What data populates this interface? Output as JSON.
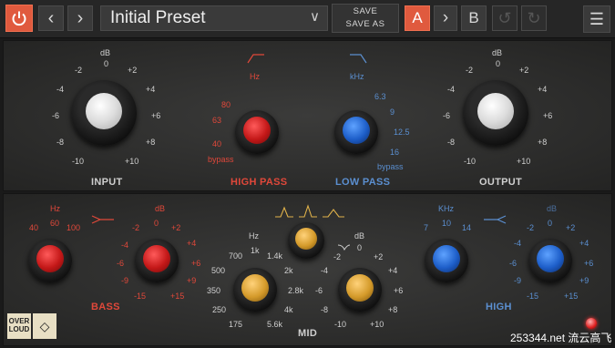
{
  "toolbar": {
    "preset_name": "Initial Preset",
    "save_label": "SAVE",
    "save_as_label": "SAVE AS",
    "a_label": "A",
    "b_label": "B"
  },
  "top": {
    "input": {
      "label": "INPUT",
      "unit": "dB",
      "scale": [
        "-10",
        "-8",
        "-6",
        "-4",
        "-2",
        "0",
        "+2",
        "+4",
        "+6",
        "+8",
        "+10"
      ]
    },
    "high_pass": {
      "label": "HIGH PASS",
      "unit": "Hz",
      "scale": [
        "bypass",
        "40",
        "63",
        "80"
      ]
    },
    "low_pass": {
      "label": "LOW PASS",
      "unit": "kHz",
      "scale": [
        "6.3",
        "9",
        "12.5",
        "16",
        "bypass"
      ]
    },
    "output": {
      "label": "OUTPUT",
      "unit": "dB",
      "scale": [
        "-10",
        "-8",
        "-6",
        "-4",
        "-2",
        "0",
        "+2",
        "+4",
        "+6",
        "+8",
        "+10"
      ]
    }
  },
  "bottom": {
    "bass": {
      "label": "BASS",
      "freq_unit": "Hz",
      "freqs": [
        "40",
        "60",
        "100"
      ],
      "gain_unit": "dB",
      "gain_scale": [
        "-15",
        "-9",
        "-6",
        "-4",
        "-2",
        "0",
        "+2",
        "+4",
        "+6",
        "+9",
        "+15"
      ]
    },
    "mid": {
      "label": "MID",
      "freq_unit": "Hz",
      "freq_scale": [
        "175",
        "250",
        "350",
        "500",
        "700",
        "1k",
        "1.4k",
        "2k",
        "2.8k",
        "4k",
        "5.6k"
      ],
      "gain_unit": "dB",
      "gain_scale": [
        "-10",
        "-8",
        "-6",
        "-4",
        "-2",
        "0",
        "+2",
        "+4",
        "+6",
        "+8",
        "+10"
      ]
    },
    "high": {
      "label": "HIGH",
      "freq_unit": "KHz",
      "freqs": [
        "7",
        "10",
        "14"
      ],
      "gain_unit": "dB",
      "gain_scale": [
        "-15",
        "-9",
        "-6",
        "-4",
        "-2",
        "0",
        "+2",
        "+4",
        "+6",
        "+9",
        "+15"
      ]
    }
  },
  "logo": {
    "line1": "OVER",
    "line2": "LOUD"
  },
  "watermark": "253344.net 流云高飞",
  "colors": {
    "accent": "#e05a3e",
    "red_knob": "#c41818",
    "blue_knob": "#1d5ec9",
    "gold_knob": "#d49a2a"
  }
}
